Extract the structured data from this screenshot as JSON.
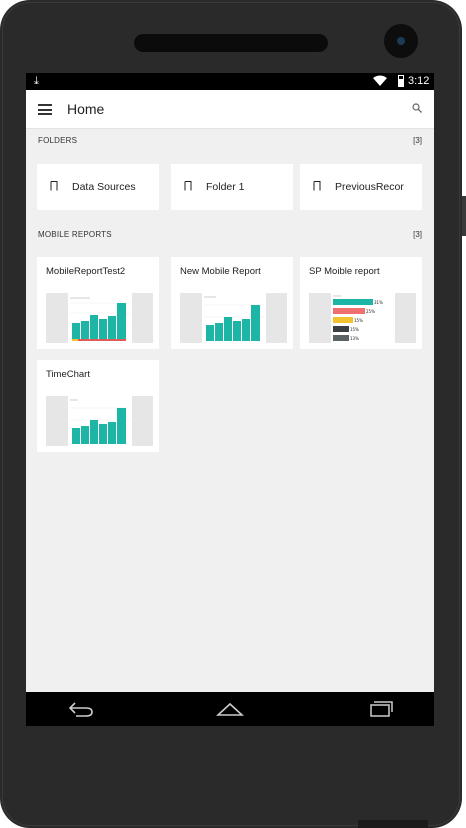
{
  "status_bar": {
    "time": "3:12",
    "icons": [
      "download-icon",
      "wifi-icon",
      "battery-icon"
    ]
  },
  "app_bar": {
    "title": "Home",
    "icons": [
      "menu-icon",
      "search-icon"
    ]
  },
  "folders": {
    "label": "FOLDERS",
    "count": "[3]",
    "items": [
      {
        "label": "Data Sources"
      },
      {
        "label": "Folder 1"
      },
      {
        "label": "PreviousRecor"
      }
    ]
  },
  "mobile_reports": {
    "label": "MOBILE REPORTS",
    "count": "[3]",
    "items": [
      {
        "title": "MobileReportTest2"
      },
      {
        "title": "New Mobile Report"
      },
      {
        "title": "SP Moible report",
        "bar_labels": [
          "31%",
          "25%",
          "15%",
          "15%",
          "13%"
        ]
      },
      {
        "title": "TimeChart"
      }
    ]
  },
  "navigation": {
    "icons": [
      "back-icon",
      "home-icon",
      "recent-apps-icon"
    ]
  },
  "colors": {
    "accent_teal": "#1db5a6",
    "red": "#e05a5a",
    "coral": "#f07070",
    "yellow": "#f2c230",
    "dark": "#3a3f44",
    "gray": "#5b6266"
  }
}
